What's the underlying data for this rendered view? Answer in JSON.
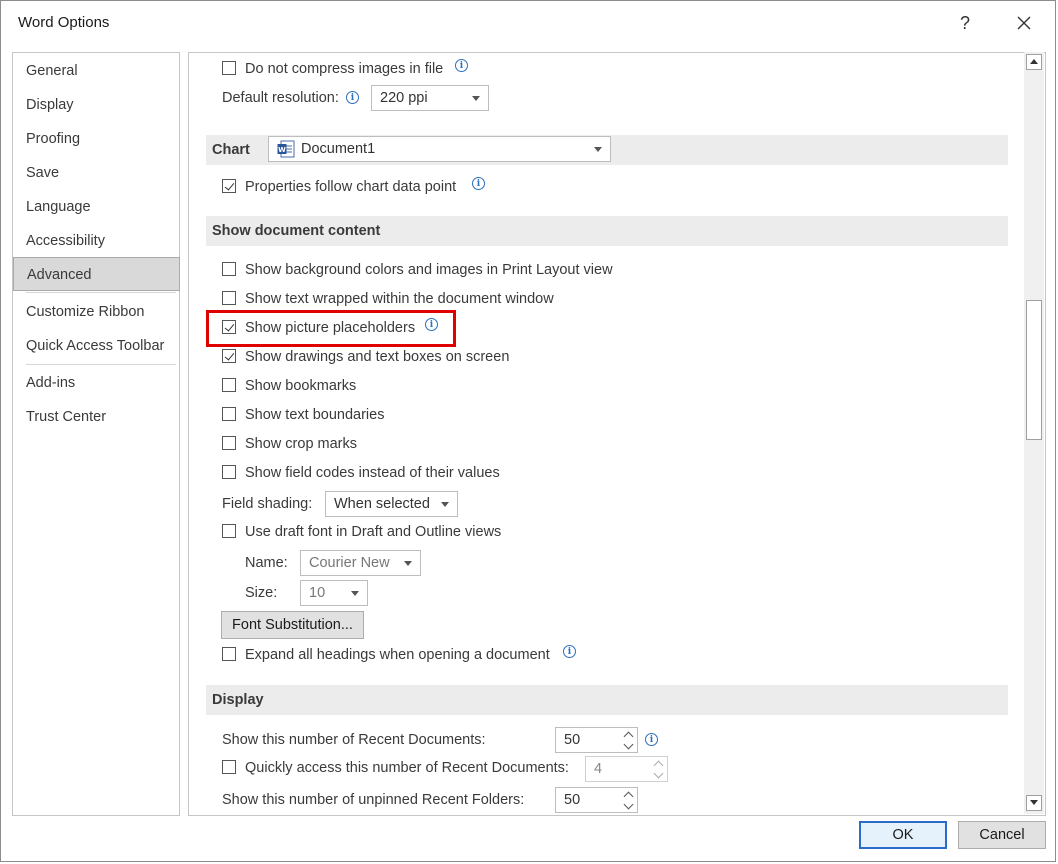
{
  "window": {
    "title": "Word Options",
    "help": "?",
    "close": "✕"
  },
  "sidebar": {
    "items": [
      {
        "label": "General"
      },
      {
        "label": "Display"
      },
      {
        "label": "Proofing"
      },
      {
        "label": "Save"
      },
      {
        "label": "Language"
      },
      {
        "label": "Accessibility"
      },
      {
        "label": "Advanced",
        "selected": true
      },
      {
        "label": "Customize Ribbon"
      },
      {
        "label": "Quick Access Toolbar"
      },
      {
        "label": "Add-ins"
      },
      {
        "label": "Trust Center"
      }
    ]
  },
  "image": {
    "no_compress_label": "Do not compress images in file",
    "no_compress_checked": false,
    "default_resolution_label": "Default resolution:",
    "default_resolution_value": "220 ppi"
  },
  "chart": {
    "section_label": "Chart",
    "document_value": "Document1",
    "properties_follow_label": "Properties follow chart data point",
    "properties_follow_checked": true
  },
  "show_content": {
    "section_label": "Show document content",
    "options": [
      {
        "label": "Show background colors and images in Print Layout view",
        "checked": false
      },
      {
        "label": "Show text wrapped within the document window",
        "checked": false
      },
      {
        "label": "Show picture placeholders",
        "checked": true
      },
      {
        "label": "Show drawings and text boxes on screen",
        "checked": true
      },
      {
        "label": "Show bookmarks",
        "checked": false
      },
      {
        "label": "Show text boundaries",
        "checked": false
      },
      {
        "label": "Show crop marks",
        "checked": false
      },
      {
        "label": "Show field codes instead of their values",
        "checked": false
      }
    ],
    "field_shading_label": "Field shading:",
    "field_shading_value": "When selected",
    "draft_font_label": "Use draft font in Draft and Outline views",
    "draft_font_checked": false,
    "name_label": "Name:",
    "name_value": "Courier New",
    "size_label": "Size:",
    "size_value": "10",
    "font_substitution_label": "Font Substitution...",
    "expand_headings_label": "Expand all headings when opening a document",
    "expand_headings_checked": false
  },
  "display": {
    "section_label": "Display",
    "recent_docs_label": "Show this number of Recent Documents:",
    "recent_docs_value": "50",
    "quick_access_label": "Quickly access this number of Recent Documents:",
    "quick_access_checked": false,
    "quick_access_value": "4",
    "unpinned_folders_label": "Show this number of unpinned Recent Folders:",
    "unpinned_folders_value": "50"
  },
  "footer": {
    "ok_label": "OK",
    "cancel_label": "Cancel"
  },
  "colors": {
    "highlight": "#e00000",
    "ok_border": "#2a6cc8",
    "info_icon": "#2b6fbd"
  }
}
